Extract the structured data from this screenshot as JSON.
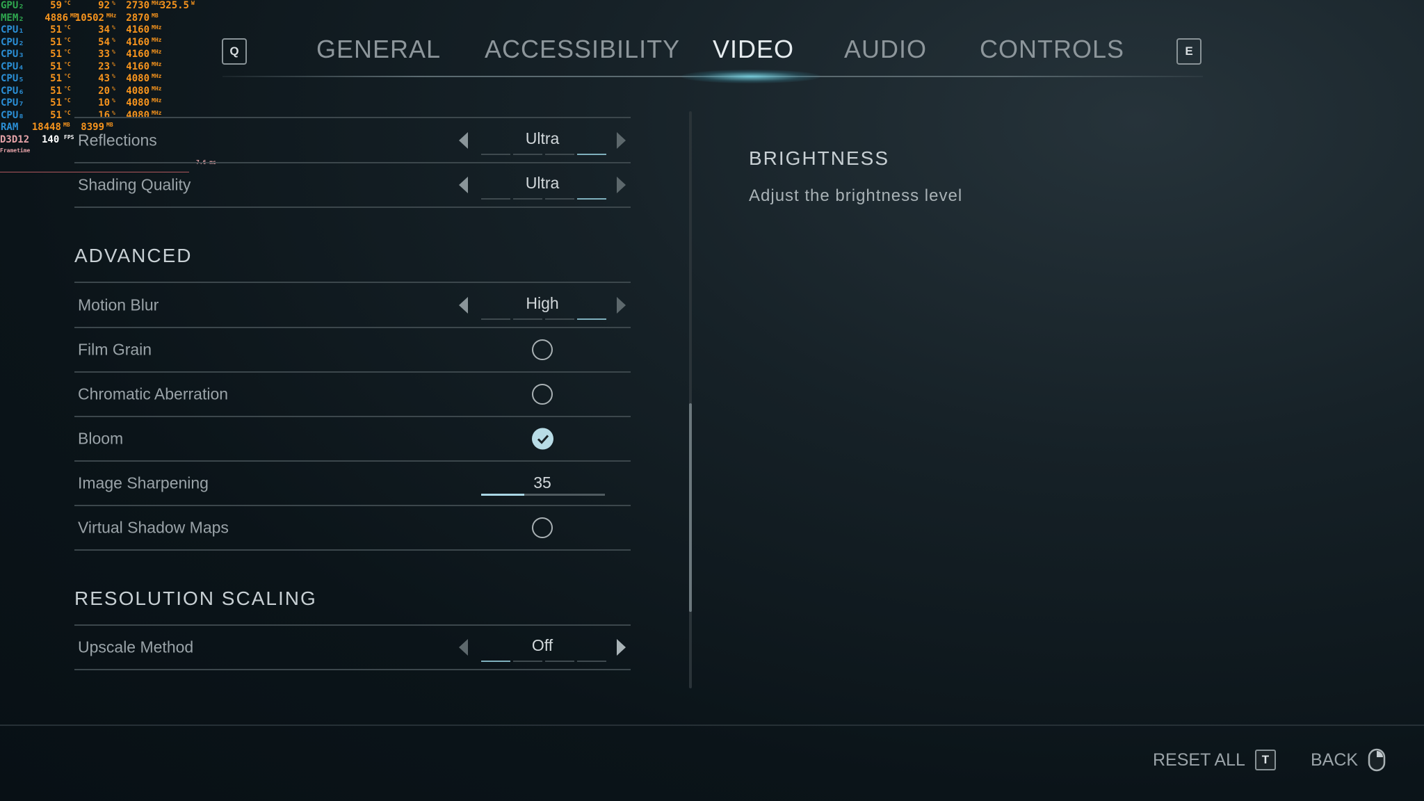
{
  "osd": {
    "rows": [
      {
        "label": "GPU₂",
        "label_color": "#2fa84f",
        "values": [
          [
            "59",
            "°C"
          ],
          [
            "92",
            "%"
          ],
          [
            "2730",
            "MHz"
          ],
          [
            "325.5",
            "W"
          ]
        ]
      },
      {
        "label": "MEM₂",
        "label_color": "#2fa84f",
        "values": [
          [
            "4886",
            "MB"
          ],
          [
            "10502",
            "MHz"
          ],
          [
            "2870",
            "MB"
          ]
        ]
      },
      {
        "label": "CPU₁",
        "label_color": "#2b8fd6",
        "values": [
          [
            "51",
            "°C"
          ],
          [
            "34",
            "%"
          ],
          [
            "4160",
            "MHz"
          ]
        ]
      },
      {
        "label": "CPU₂",
        "label_color": "#2b8fd6",
        "values": [
          [
            "51",
            "°C"
          ],
          [
            "54",
            "%"
          ],
          [
            "4160",
            "MHz"
          ]
        ]
      },
      {
        "label": "CPU₃",
        "label_color": "#2b8fd6",
        "values": [
          [
            "51",
            "°C"
          ],
          [
            "33",
            "%"
          ],
          [
            "4160",
            "MHz"
          ]
        ]
      },
      {
        "label": "CPU₄",
        "label_color": "#2b8fd6",
        "values": [
          [
            "51",
            "°C"
          ],
          [
            "23",
            "%"
          ],
          [
            "4160",
            "MHz"
          ]
        ]
      },
      {
        "label": "CPU₅",
        "label_color": "#2b8fd6",
        "values": [
          [
            "51",
            "°C"
          ],
          [
            "43",
            "%"
          ],
          [
            "4080",
            "MHz"
          ]
        ]
      },
      {
        "label": "CPU₆",
        "label_color": "#2b8fd6",
        "values": [
          [
            "51",
            "°C"
          ],
          [
            "20",
            "%"
          ],
          [
            "4080",
            "MHz"
          ]
        ]
      },
      {
        "label": "CPU₇",
        "label_color": "#2b8fd6",
        "values": [
          [
            "51",
            "°C"
          ],
          [
            "10",
            "%"
          ],
          [
            "4080",
            "MHz"
          ]
        ]
      },
      {
        "label": "CPU₈",
        "label_color": "#2b8fd6",
        "values": [
          [
            "51",
            "°C"
          ],
          [
            "16",
            "%"
          ],
          [
            "4080",
            "MHz"
          ]
        ]
      },
      {
        "label": "RAM",
        "label_color": "#2b8fd6",
        "values": [
          [
            "18448",
            "MB"
          ],
          [
            "8399",
            "MB"
          ]
        ]
      }
    ],
    "api": "D3D12",
    "fps": "140",
    "fps_unit": "FPS",
    "frametime_label": "Frametime",
    "frametime_value": "7.6 ms"
  },
  "nav": {
    "prev_key": "Q",
    "next_key": "E",
    "tabs": [
      {
        "label": "GENERAL"
      },
      {
        "label": "ACCESSIBILITY"
      },
      {
        "label": "VIDEO",
        "active": true
      },
      {
        "label": "AUDIO"
      },
      {
        "label": "CONTROLS"
      }
    ]
  },
  "settings": {
    "reflections": {
      "label": "Reflections",
      "value": "Ultra"
    },
    "shading": {
      "label": "Shading Quality",
      "value": "Ultra"
    },
    "advanced_title": "ADVANCED",
    "motion_blur": {
      "label": "Motion Blur",
      "value": "High"
    },
    "film_grain": {
      "label": "Film Grain",
      "checked": false
    },
    "chromatic": {
      "label": "Chromatic Aberration",
      "checked": false
    },
    "bloom": {
      "label": "Bloom",
      "checked": true
    },
    "sharpening": {
      "label": "Image Sharpening",
      "value": "35",
      "percent": 35
    },
    "vsm": {
      "label": "Virtual Shadow Maps",
      "checked": false
    },
    "resolution_title": "RESOLUTION SCALING",
    "upscale": {
      "label": "Upscale Method",
      "value": "Off"
    }
  },
  "info": {
    "title": "BRIGHTNESS",
    "description": "Adjust the brightness level"
  },
  "footer": {
    "reset_label": "RESET ALL",
    "reset_key": "T",
    "back_label": "BACK"
  },
  "colors": {
    "accent": "#a9d6e4",
    "background": "#0b1419"
  }
}
